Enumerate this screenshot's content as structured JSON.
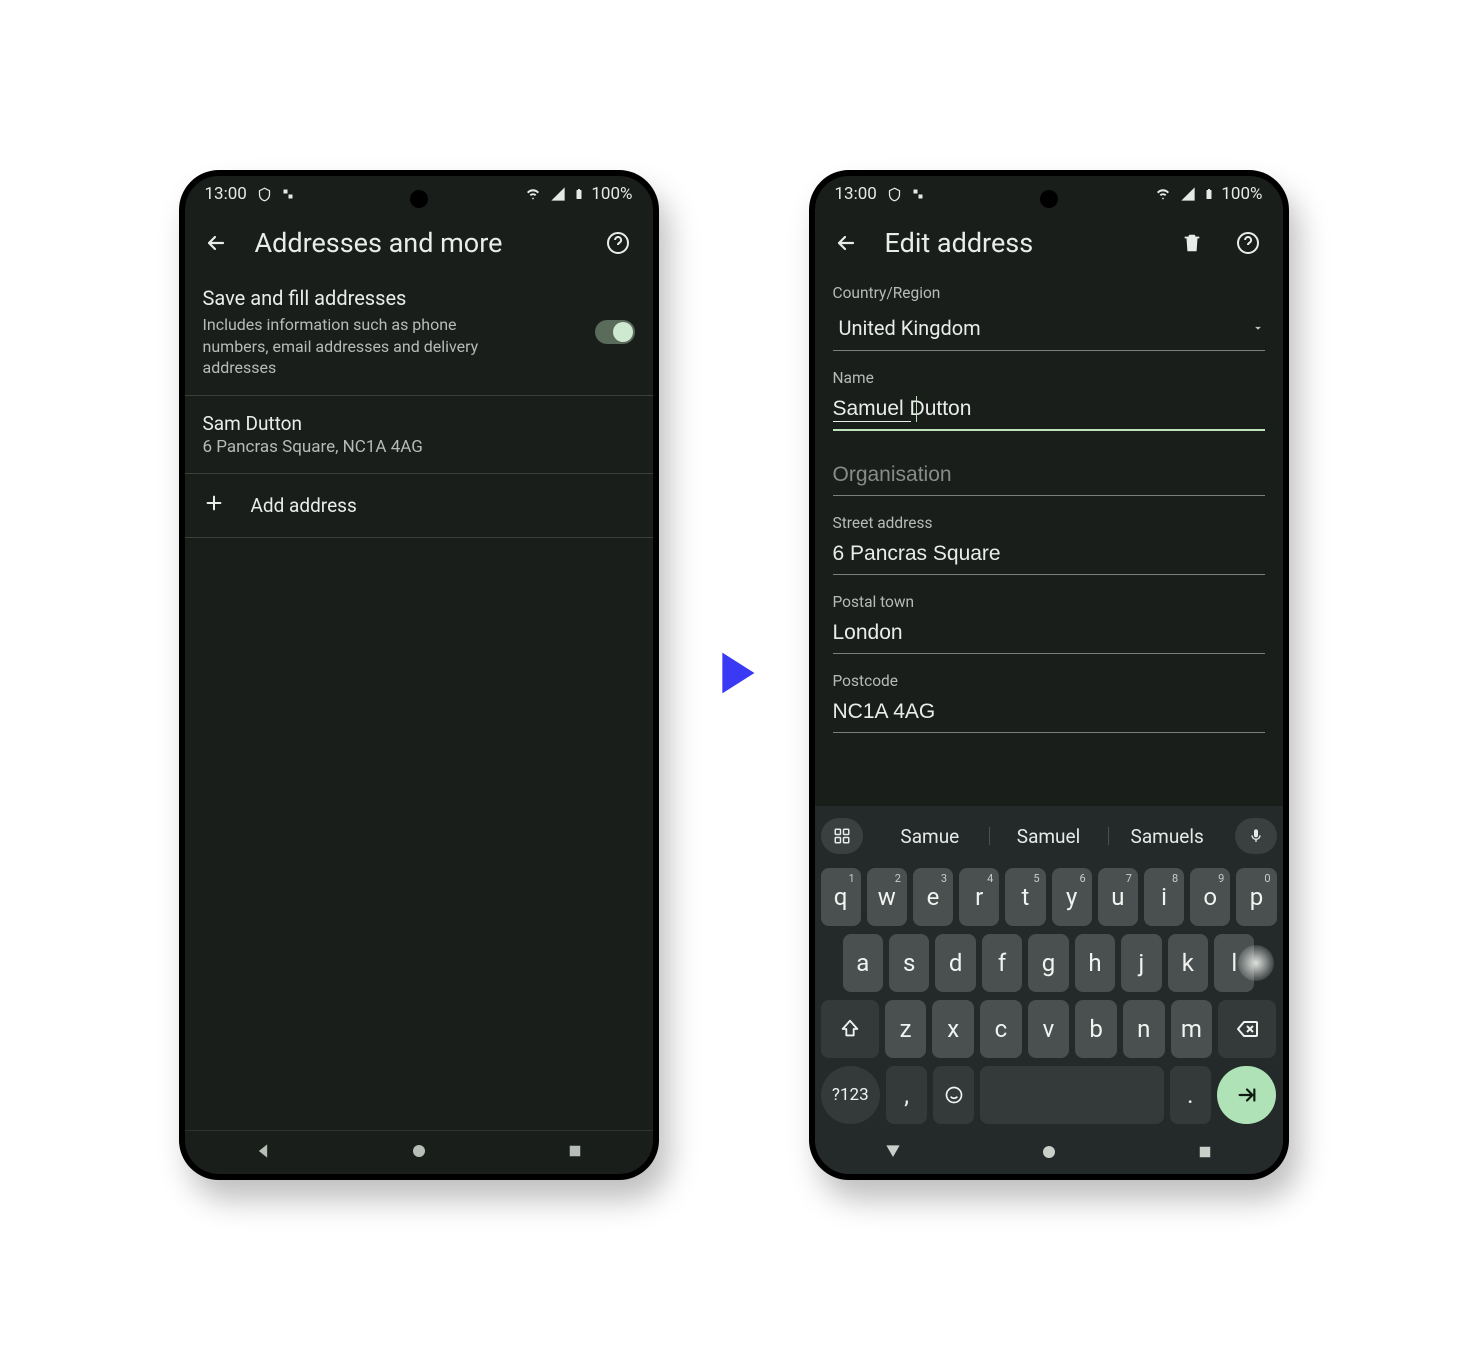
{
  "status": {
    "time": "13:00",
    "battery": "100%"
  },
  "screen1": {
    "title": "Addresses and more",
    "save_title": "Save and fill addresses",
    "save_sub": "Includes information such as phone numbers, email addresses and delivery addresses",
    "addr_name": "Sam Dutton",
    "addr_line": "6 Pancras Square, NC1A 4AG",
    "add_label": "Add address"
  },
  "screen2": {
    "title": "Edit address",
    "country_label": "Country/Region",
    "country_value": "United Kingdom",
    "name_label": "Name",
    "name_value": "Samuel Dutton",
    "org_label": "Organisation",
    "org_value": "",
    "street_label": "Street address",
    "street_value": "6 Pancras Square",
    "town_label": "Postal town",
    "town_value": "London",
    "postcode_label": "Postcode",
    "postcode_value": "NC1A 4AG"
  },
  "kbd": {
    "suggestions": [
      "Samue",
      "Samuel",
      "Samuels"
    ],
    "row1": [
      "q",
      "w",
      "e",
      "r",
      "t",
      "y",
      "u",
      "i",
      "o",
      "p"
    ],
    "sups": [
      "1",
      "2",
      "3",
      "4",
      "5",
      "6",
      "7",
      "8",
      "9",
      "0"
    ],
    "row2": [
      "a",
      "s",
      "d",
      "f",
      "g",
      "h",
      "j",
      "k",
      "l"
    ],
    "row3": [
      "z",
      "x",
      "c",
      "v",
      "b",
      "n",
      "m"
    ],
    "numkey": "?123",
    "comma": ",",
    "dot": "."
  }
}
